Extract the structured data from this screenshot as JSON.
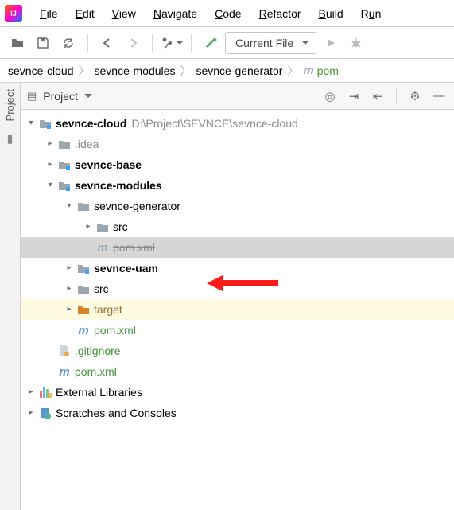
{
  "menu": {
    "items": [
      "File",
      "Edit",
      "View",
      "Navigate",
      "Code",
      "Refactor",
      "Build",
      "Run"
    ]
  },
  "toolbar": {
    "run_config": "Current File"
  },
  "breadcrumb": {
    "items": [
      "sevnce-cloud",
      "sevnce-modules",
      "sevnce-generator"
    ],
    "file": "pom"
  },
  "sidebar": {
    "label": "Project"
  },
  "panel": {
    "title": "Project"
  },
  "tree": {
    "root": {
      "name": "sevnce-cloud",
      "path": "D:\\Project\\SEVNCE\\sevnce-cloud"
    },
    "idea": ".idea",
    "base": "sevnce-base",
    "modules": "sevnce-modules",
    "generator": "sevnce-generator",
    "src1": "src",
    "pom_strike": "pom.xml",
    "uam": "sevnce-uam",
    "src2": "src",
    "target": "target",
    "pom2": "pom.xml",
    "gitignore": ".gitignore",
    "pom3": "pom.xml",
    "ext_lib": "External Libraries",
    "scratch": "Scratches and Consoles"
  }
}
